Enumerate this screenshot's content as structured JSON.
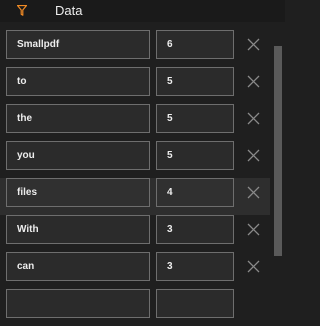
{
  "header": {
    "title": "Data",
    "icon": "filter-icon",
    "icon_color": "#f08a24"
  },
  "rows": [
    {
      "word": "Smallpdf",
      "count": "6"
    },
    {
      "word": "to",
      "count": "5"
    },
    {
      "word": "the",
      "count": "5"
    },
    {
      "word": "you",
      "count": "5"
    },
    {
      "word": "files",
      "count": "4"
    },
    {
      "word": "With",
      "count": "3"
    },
    {
      "word": "can",
      "count": "3"
    }
  ],
  "colors": {
    "background": "#1f1f1f",
    "field_background": "#2b2b2b",
    "field_border": "#6e6e6e",
    "hover_row": "#2e2e2e",
    "delete_icon": "#8a8a8a"
  }
}
